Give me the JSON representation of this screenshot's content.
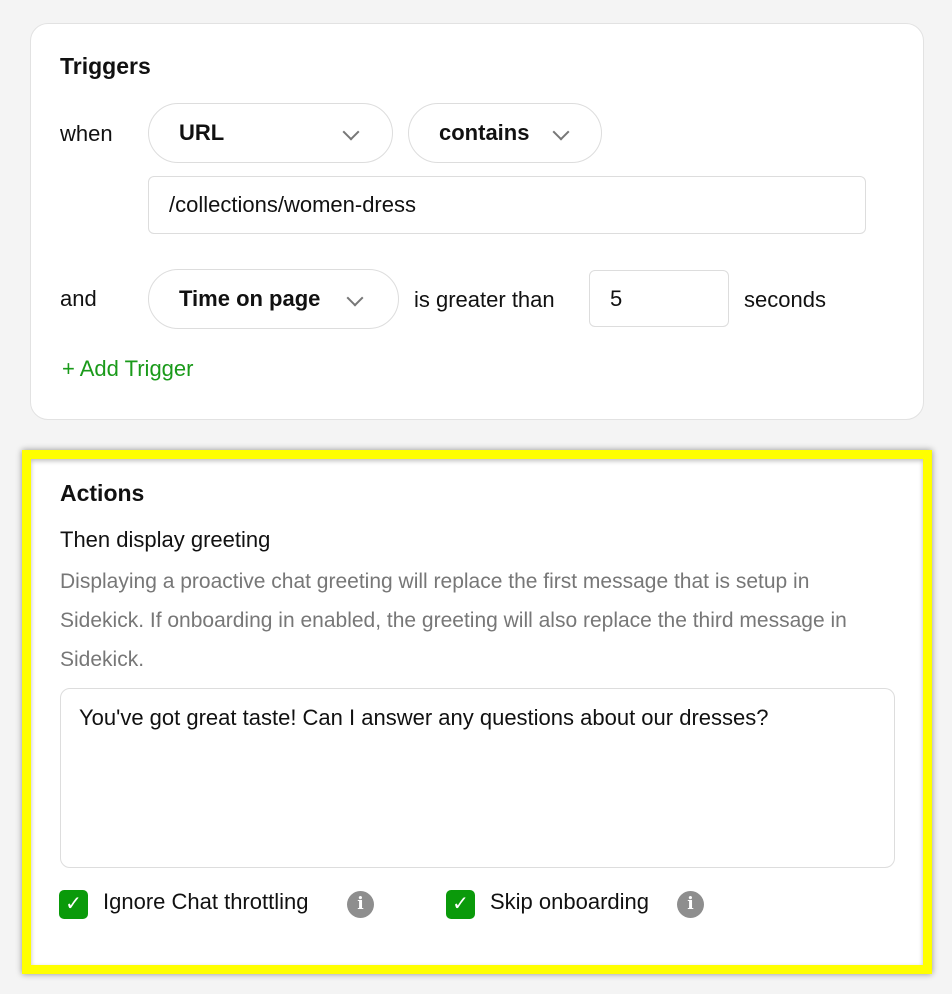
{
  "triggers": {
    "title": "Triggers",
    "when": "when",
    "field": "URL",
    "operator": "contains",
    "url_value": "/collections/women-dress",
    "and": "and",
    "condition": "Time on page",
    "comparison": "is greater than",
    "seconds_value": "5",
    "unit": "seconds",
    "add_trigger": "+ Add Trigger"
  },
  "actions": {
    "title": "Actions",
    "subtitle": "Then display greeting",
    "description": "Displaying a proactive chat greeting will replace the first message that is setup in Sidekick. If onboarding in enabled, the greeting will also replace the third message in Sidekick.",
    "greeting": "You've got great taste! Can I answer any questions about our dresses?",
    "checkboxes": [
      {
        "label": "Ignore Chat throttling",
        "checked": true
      },
      {
        "label": "Skip onboarding",
        "checked": true
      }
    ]
  },
  "colors": {
    "accent": "#0a9a0a",
    "highlight": "#ffff00"
  }
}
